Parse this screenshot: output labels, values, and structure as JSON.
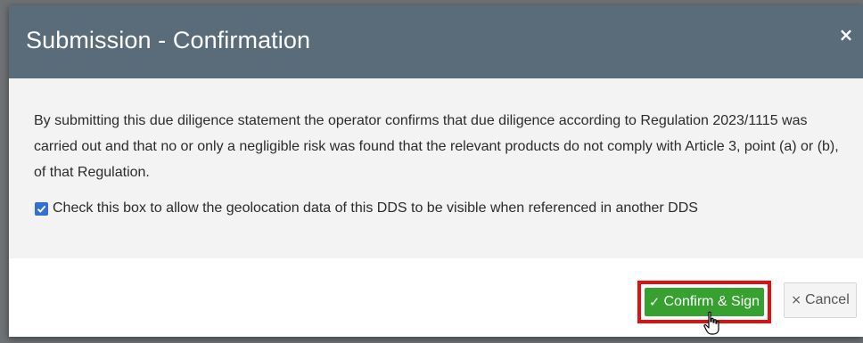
{
  "dialog": {
    "title": "Submission - Confirmation",
    "close_glyph": "×",
    "statement": "By submitting this due diligence statement the operator confirms that due diligence according to Regulation 2023/1115 was carried out and that no or only a negligible risk was found that the relevant products do not comply with Article 3, point (a) or (b), of that Regulation.",
    "geolocation_checkbox": {
      "checked": true,
      "label": "Check this box to allow the geolocation data of this DDS to be visible when referenced in another DDS"
    },
    "confirm_button": {
      "icon": "check-icon",
      "glyph": "✓",
      "label": "Confirm & Sign"
    },
    "cancel_button": {
      "icon": "close-icon",
      "glyph": "×",
      "label": "Cancel"
    }
  },
  "colors": {
    "header_bg": "#5a6b7a",
    "body_bg": "#f3f3f3",
    "confirm_bg": "#37a12f",
    "highlight_border": "#e01010",
    "checkbox_bg": "#2f6fd6"
  }
}
